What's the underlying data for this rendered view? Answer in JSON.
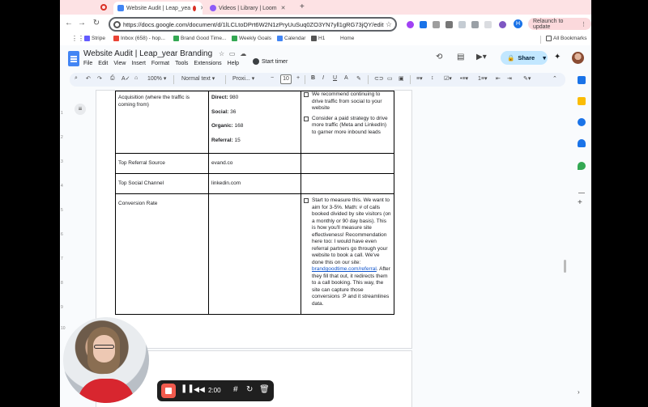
{
  "browser": {
    "tabs": [
      {
        "title": "Website Audit | Leap_year Branding",
        "short": "Website Audit | Leap_yea"
      },
      {
        "title": "Videos | Library | Loom",
        "short": "Videos | Library | Loom"
      }
    ],
    "url": "https://docs.google.com/document/d/1lLCLtoDPrt6W2N1zPryUuSuq0ZO3YN7yll1gRG73jQY/edit?tab...",
    "url_short": "https://docs.google.com/document/d/1lLCLtoDPrt6W2N1zPryUuSuq0ZO3YN7yll1gRG73jQY/edit?tab...",
    "relaunch_label": "Relaunch to update",
    "profile_initial": "H",
    "bookmarks": [
      {
        "label": "Stripe"
      },
      {
        "label": "Inbox (658) - hop..."
      },
      {
        "label": "Brand Good Time..."
      },
      {
        "label": "Weekly Goals"
      },
      {
        "label": "Calendar"
      },
      {
        "label": "H1"
      },
      {
        "label": "Home"
      }
    ],
    "all_bookmarks": "All Bookmarks"
  },
  "docs": {
    "title": "Website Audit | Leap_year Branding",
    "menu": [
      "File",
      "Edit",
      "View",
      "Insert",
      "Format",
      "Tools",
      "Extensions",
      "Help"
    ],
    "start_timer": "Start timer",
    "share": "Share",
    "toolbar": {
      "zoom": "100%",
      "style": "Normal text",
      "font": "Proxi...",
      "font_size": "10"
    }
  },
  "table": {
    "rows": [
      {
        "label": "Acquisition (where the traffic is coming from)",
        "metrics": [
          {
            "name": "Direct:",
            "value": " 980"
          },
          {
            "name": "Social:",
            "value": " 36"
          },
          {
            "name": "Organic:",
            "value": " 168"
          },
          {
            "name": "Referral:",
            "value": " 15"
          }
        ],
        "notes": [
          "We recommend continuing to drive traffic from social to your website",
          "Consider a paid strategy to drive more traffic (Meta and LinkedIn) to garner more inbound leads"
        ]
      },
      {
        "label": "Top Referral Source",
        "value": "evand.co"
      },
      {
        "label": "Top Social Channel",
        "value": "linkedin.com"
      },
      {
        "label": "Conversion Rate",
        "note_before_link": "Start to measure this. We want to aim for 3-5%. Math: # of calls booked divided by site visitors (on a monthly or 90 day basis). This is how you'll measure site effectiveness! Recommendation here too: I would have even referral partners go through your website to book a call. We've done this on our site: ",
        "note_link": "brandgoodtime.com/referral",
        "note_after_link": ". After they fill that out, it redirects them to a call booking. This way, the site can capture those conversions :P and it streamlines data."
      }
    ]
  },
  "loom": {
    "time": "2:00"
  },
  "ruler": [
    "1",
    "2",
    "3",
    "4",
    "5",
    "6",
    "7",
    "8",
    "9",
    "10"
  ]
}
